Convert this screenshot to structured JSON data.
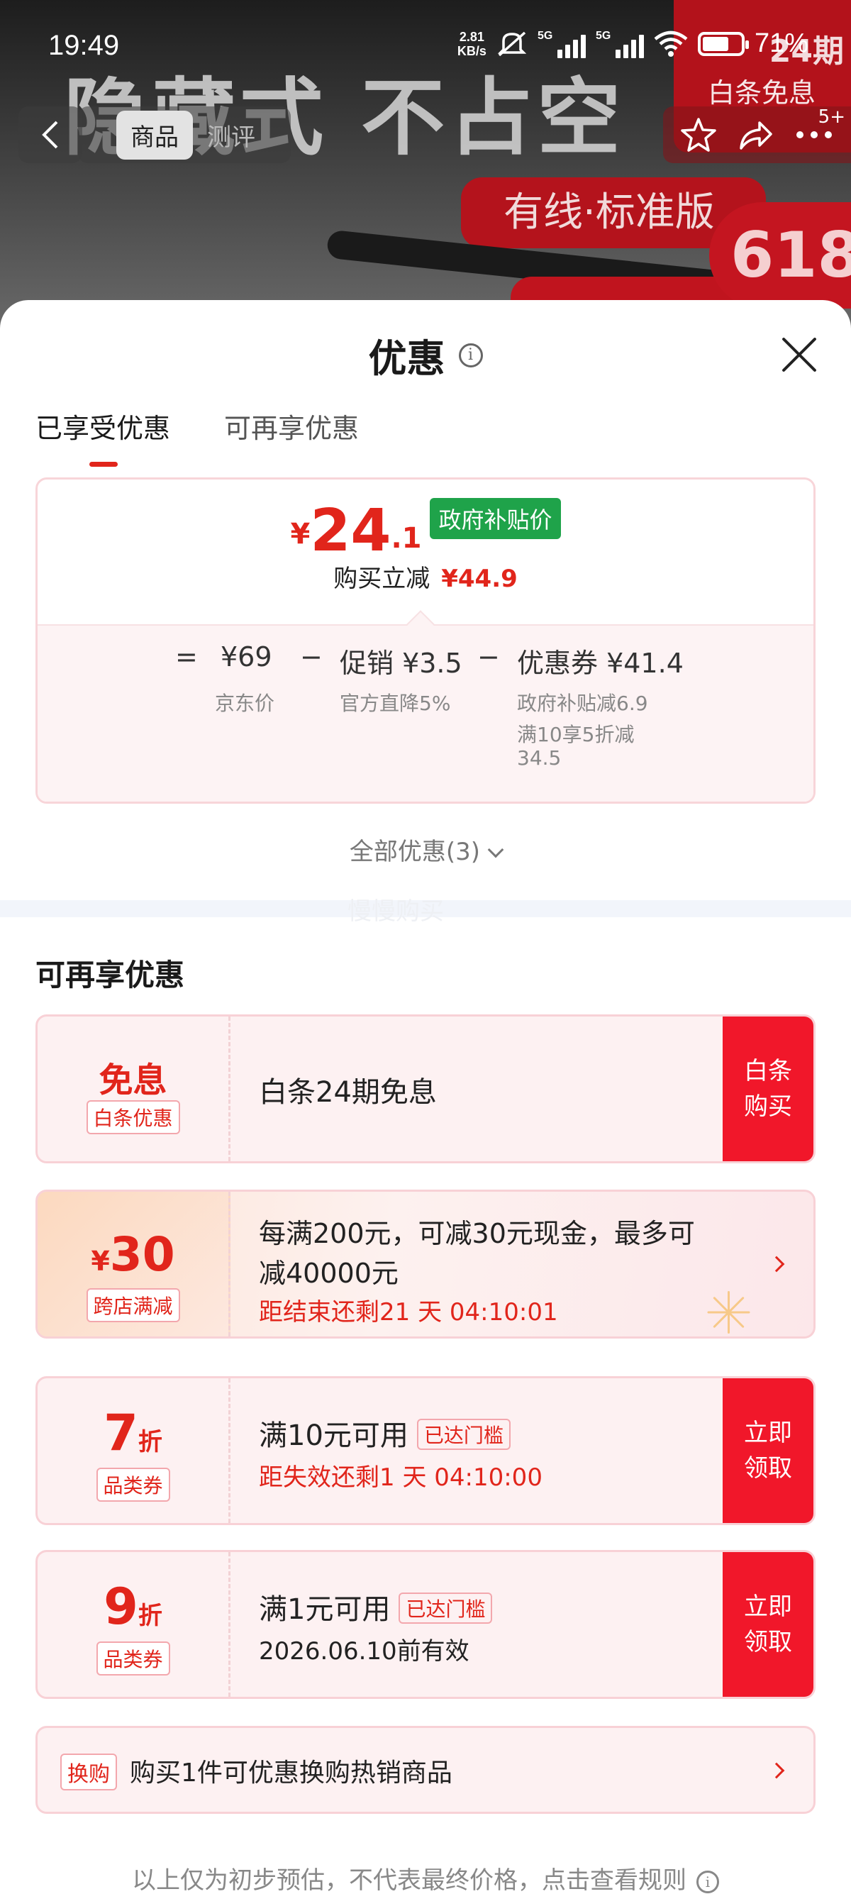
{
  "status_bar": {
    "time": "19:49",
    "net_speed_value": "2.81",
    "net_speed_unit": "KB/s",
    "sig1_gen": "5G",
    "sig2_gen": "5G",
    "battery_pct": "71%"
  },
  "background": {
    "headline": "隐藏式 不占空",
    "card_line1": "24期",
    "card_line2": "白条免息",
    "pill": "有线·标准版",
    "promo": "618"
  },
  "top_nav": {
    "tab_product": "商品",
    "tab_review": "测评",
    "badge": "5+"
  },
  "sheet": {
    "title": "优惠",
    "tabs": [
      {
        "label": "已享受优惠",
        "active": true
      },
      {
        "label": "可再享优惠",
        "active": false
      }
    ],
    "price": {
      "currency": "¥",
      "integer": "24",
      "decimal": ".1",
      "tag": "政府补贴价",
      "reduce_label": "购买立减",
      "reduce_amount": "¥44.9"
    },
    "formula": {
      "eq": "=",
      "jd_price": "¥69",
      "jd_label": "京东价",
      "minus": "−",
      "promo": "促销 ¥3.5",
      "promo_label": "官方直降5%",
      "coupon": "优惠券 ¥41.4",
      "coupon_line1": "政府补贴减6.9",
      "coupon_line2": "满10享5折减",
      "coupon_line3": "34.5"
    },
    "all_discounts": "全部优惠(3)",
    "watermark": "慢慢购买",
    "section_title": "可再享优惠",
    "cards": [
      {
        "big": "免息",
        "tag": "白条优惠",
        "main": "白条24期免息",
        "button": "白条购买"
      },
      {
        "yen": "¥",
        "big": "30",
        "tag": "跨店满减",
        "main_line1": "每满200元，可减30元现金，最多可",
        "main_line2": "减40000元",
        "countdown": "距结束还剩21 天 04:10:01"
      },
      {
        "big": "7",
        "unit": "折",
        "tag": "品类券",
        "main": "满10元可用",
        "reach": "已达门槛",
        "countdown": "距失效还剩1 天 04:10:00",
        "button": "立即领取"
      },
      {
        "big": "9",
        "unit": "折",
        "tag": "品类券",
        "main": "满1元可用",
        "reach": "已达门槛",
        "valid": "2026.06.10前有效",
        "button": "立即领取"
      }
    ],
    "trade": {
      "tag": "换购",
      "text": "购买1件可优惠换购热销商品"
    },
    "footnote": "以上仅为初步预估，不代表最终价格，点击查看规则"
  },
  "colors": {
    "accent_red": "#e1251b",
    "button_red": "#f1172a",
    "gov_green": "#1fa34a"
  },
  "icons": [
    "back-icon",
    "star-icon",
    "share-icon",
    "more-icon",
    "info-icon",
    "close-icon",
    "chevron-down-icon",
    "chevron-right-icon"
  ]
}
